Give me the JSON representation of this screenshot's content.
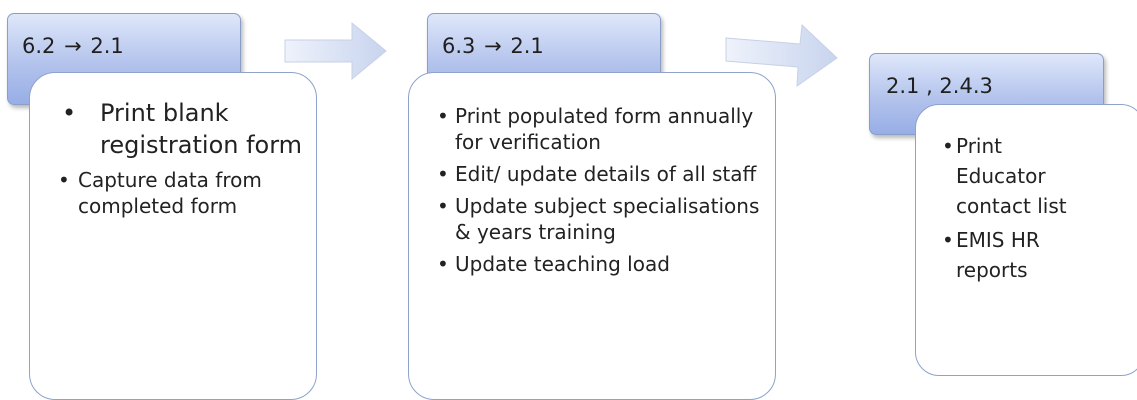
{
  "steps": [
    {
      "code_from": "6.2",
      "code_to": "2.1",
      "items": [
        {
          "text": "Print blank registration form",
          "size": "large"
        },
        {
          "text": "Capture data from completed form",
          "size": "small"
        }
      ]
    },
    {
      "code_from": "6.3",
      "code_to": "2.1",
      "items": [
        {
          "text": "Print populated form annually for verification",
          "size": "small"
        },
        {
          "text": "Edit/ update details of all staff",
          "size": "small"
        },
        {
          "text": "Update subject specialisations & years training",
          "size": "small"
        },
        {
          "text": "Update teaching load",
          "size": "small"
        }
      ]
    },
    {
      "code": "2.1 , 2.4.3",
      "items": [
        {
          "text": "Print Educator contact list",
          "size": "small"
        },
        {
          "text": "EMIS HR reports",
          "size": "small"
        }
      ]
    }
  ],
  "glyphs": {
    "arrow": "→",
    "bullet_large": "•",
    "bullet_small": "•"
  },
  "colors": {
    "header_top": "#dfe7fa",
    "header_bottom": "#97aee6",
    "header_border": "#8a9fc8",
    "card_border": "#8ea2cc",
    "flow_arrow_fill": "#d5def2"
  }
}
